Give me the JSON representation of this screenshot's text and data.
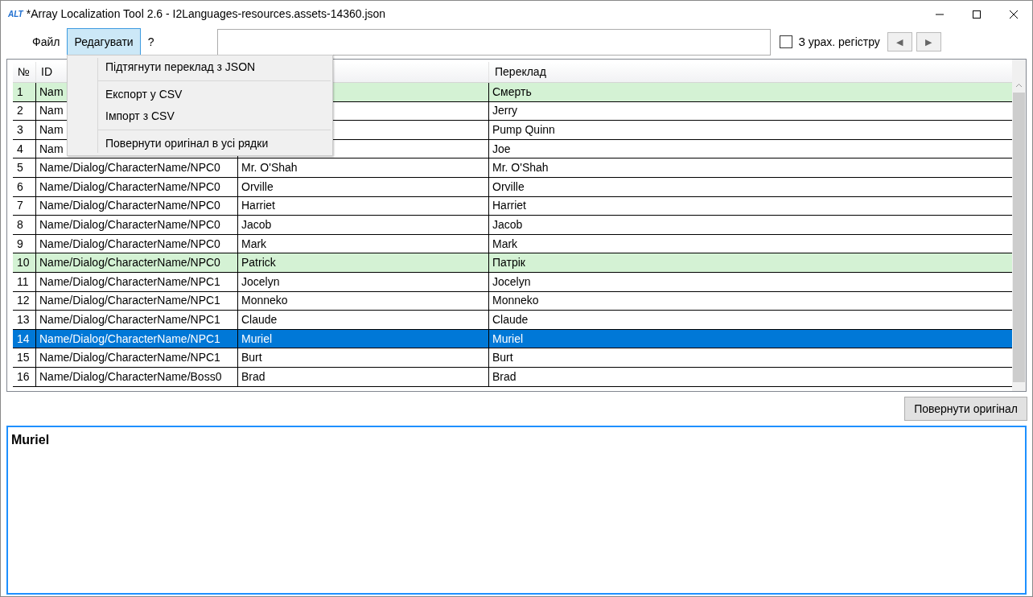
{
  "window": {
    "app_icon": "ALT",
    "title": "*Array Localization Tool 2.6 - I2Languages-resources.assets-14360.json"
  },
  "menu": [
    {
      "label": "Файл",
      "selected": false
    },
    {
      "label": "Редагувати",
      "selected": true
    },
    {
      "label": "?",
      "selected": false
    }
  ],
  "search": {
    "case_sensitive_label": "З урах. регістру",
    "case_sensitive_checked": false,
    "prev": "◀",
    "next": "▶"
  },
  "table": {
    "header": {
      "number": "№",
      "id": "ID",
      "translation": "Переклад"
    },
    "rows": [
      {
        "number": "1",
        "id": "Nam",
        "translation": "Смерть",
        "translated": true,
        "selected": false
      },
      {
        "number": "2",
        "id": "Nam",
        "translation": "Jerry",
        "translated": false,
        "selected": false
      },
      {
        "number": "3",
        "id": "Nam",
        "translation": "Pump Quinn",
        "translated": false,
        "selected": false
      },
      {
        "number": "4",
        "id": "Nam",
        "translation": "Joe",
        "translated": false,
        "selected": false
      },
      {
        "number": "5",
        "id": "Name/Dialog/CharacterName/NPC0",
        "original": "Mr. O'Shah",
        "translation": "Mr. O'Shah",
        "translated": false,
        "selected": false
      },
      {
        "number": "6",
        "id": "Name/Dialog/CharacterName/NPC0",
        "original": "Orville",
        "translation": "Orville",
        "translated": false,
        "selected": false
      },
      {
        "number": "7",
        "id": "Name/Dialog/CharacterName/NPC0",
        "original": "Harriet",
        "translation": "Harriet",
        "translated": false,
        "selected": false
      },
      {
        "number": "8",
        "id": "Name/Dialog/CharacterName/NPC0",
        "original": "Jacob",
        "translation": "Jacob",
        "translated": false,
        "selected": false
      },
      {
        "number": "9",
        "id": "Name/Dialog/CharacterName/NPC0",
        "original": "Mark",
        "translation": "Mark",
        "translated": false,
        "selected": false
      },
      {
        "number": "10",
        "id": "Name/Dialog/CharacterName/NPC0",
        "original": "Patrick",
        "translation": "Патрік",
        "translated": true,
        "selected": false
      },
      {
        "number": "11",
        "id": "Name/Dialog/CharacterName/NPC1",
        "original": "Jocelyn",
        "translation": "Jocelyn",
        "translated": false,
        "selected": false
      },
      {
        "number": "12",
        "id": "Name/Dialog/CharacterName/NPC1",
        "original": "Monneko",
        "translation": "Monneko",
        "translated": false,
        "selected": false
      },
      {
        "number": "13",
        "id": "Name/Dialog/CharacterName/NPC1",
        "original": "Claude",
        "translation": "Claude",
        "translated": false,
        "selected": false
      },
      {
        "number": "14",
        "id": "Name/Dialog/CharacterName/NPC1",
        "original": "Muriel",
        "translation": "Muriel",
        "selected": true
      },
      {
        "number": "15",
        "id": "Name/Dialog/CharacterName/NPC1",
        "original": "Burt",
        "translation": "Burt",
        "translated": false,
        "selected": false
      },
      {
        "number": "16",
        "id": "Name/Dialog/CharacterName/Boss0",
        "original": "Brad",
        "translation": "Brad",
        "translated": false,
        "selected": false
      }
    ]
  },
  "revert_button": "Повернути оригінал",
  "editor": {
    "value": "Muriel"
  },
  "dropdown": {
    "groups": [
      [
        "Підтягнути переклад з JSON"
      ],
      [
        "Експорт у CSV",
        "Імпорт з CSV"
      ],
      [
        "Повернути оригінал в усі рядки"
      ]
    ]
  }
}
